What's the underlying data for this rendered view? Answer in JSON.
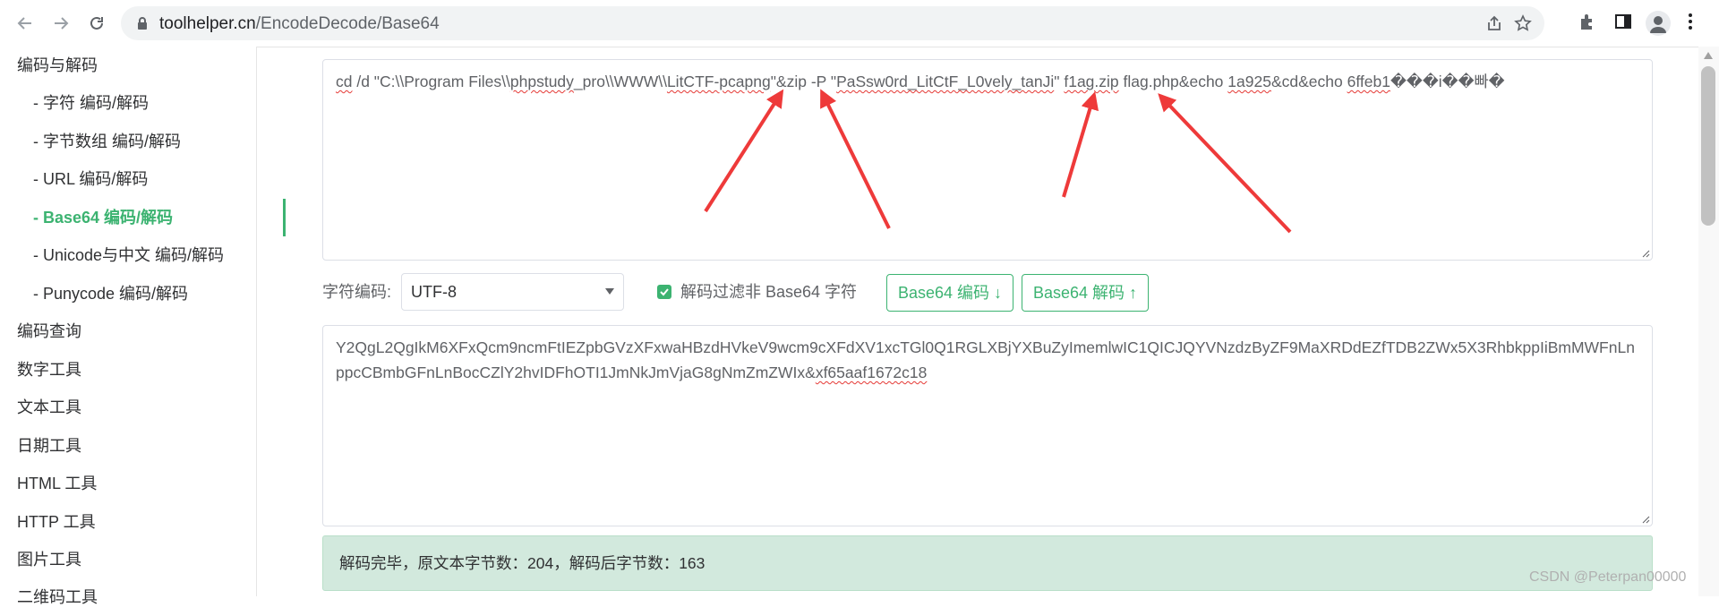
{
  "browser": {
    "url_host": "toolhelper.cn",
    "url_path": "/EncodeDecode/Base64"
  },
  "sidebar": {
    "items": [
      {
        "label": "编码与解码",
        "level": "group"
      },
      {
        "label": "- 字符  编码/解码",
        "level": "sub"
      },
      {
        "label": "- 字节数组  编码/解码",
        "level": "sub"
      },
      {
        "label": "- URL  编码/解码",
        "level": "sub"
      },
      {
        "label": "- Base64  编码/解码",
        "level": "sub",
        "active": true
      },
      {
        "label": "- Unicode与中文  编码/解码",
        "level": "sub"
      },
      {
        "label": "- Punycode  编码/解码",
        "level": "sub"
      },
      {
        "label": "编码查询",
        "level": "group"
      },
      {
        "label": "数字工具",
        "level": "group"
      },
      {
        "label": "文本工具",
        "level": "group"
      },
      {
        "label": "日期工具",
        "level": "group"
      },
      {
        "label": "HTML 工具",
        "level": "group"
      },
      {
        "label": "HTTP 工具",
        "level": "group"
      },
      {
        "label": "图片工具",
        "level": "group"
      },
      {
        "label": "二维码工具",
        "level": "group"
      }
    ]
  },
  "decoded": {
    "part1": "cd",
    "part2": " /d \"C:\\\\Program Files\\\\",
    "part3": "phpstudy",
    "part4": "_pro\\\\WWW\\\\",
    "part5": "LitCTF-pcapng",
    "part6": "\"&zip -P \"",
    "part7": "PaSsw0rd_LitCtF_L0vely_tanJi",
    "part8": "\" ",
    "part9": "f1ag.zip",
    "part10": " flag.php&echo ",
    "part11": "1a925",
    "part12": "&cd&echo ",
    "part13": "6ffeb1",
    "part14": "���i��빠�"
  },
  "controls": {
    "charset_label": "字符编码:",
    "charset_value": "UTF-8",
    "filter_label": "解码过滤非 Base64 字符",
    "filter_checked": true,
    "encode_button": "Base64 编码 ↓",
    "decode_button": "Base64 解码 ↑"
  },
  "encoded": {
    "text_main": "Y2QgL2QgIkM6XFxQcm9ncmFtIEZpbGVzXFxwaHBzdHVkeV9wcm9cXFdXV1xcTGl0Q1RGLXBjYXBuZyImemlwIC1QICJQYVNzdzByZF9MaXRDdEZfTDB2ZWx5X3RhbkppIiBmMWFnLnppcCBmbGFnLnBocCZlY2hvIDFhOTI1JmNkJmVjaG8gNmZmZWIx&",
    "text_tail": "xf65aaf1672c18"
  },
  "status": {
    "message": "解码完毕，原文本字节数：204，解码后字节数：163"
  },
  "watermark": "CSDN @Peterpan00000",
  "colors": {
    "accent": "#3cb371",
    "status_bg": "#d2e9dd",
    "arrow": "#ee3a3a"
  }
}
